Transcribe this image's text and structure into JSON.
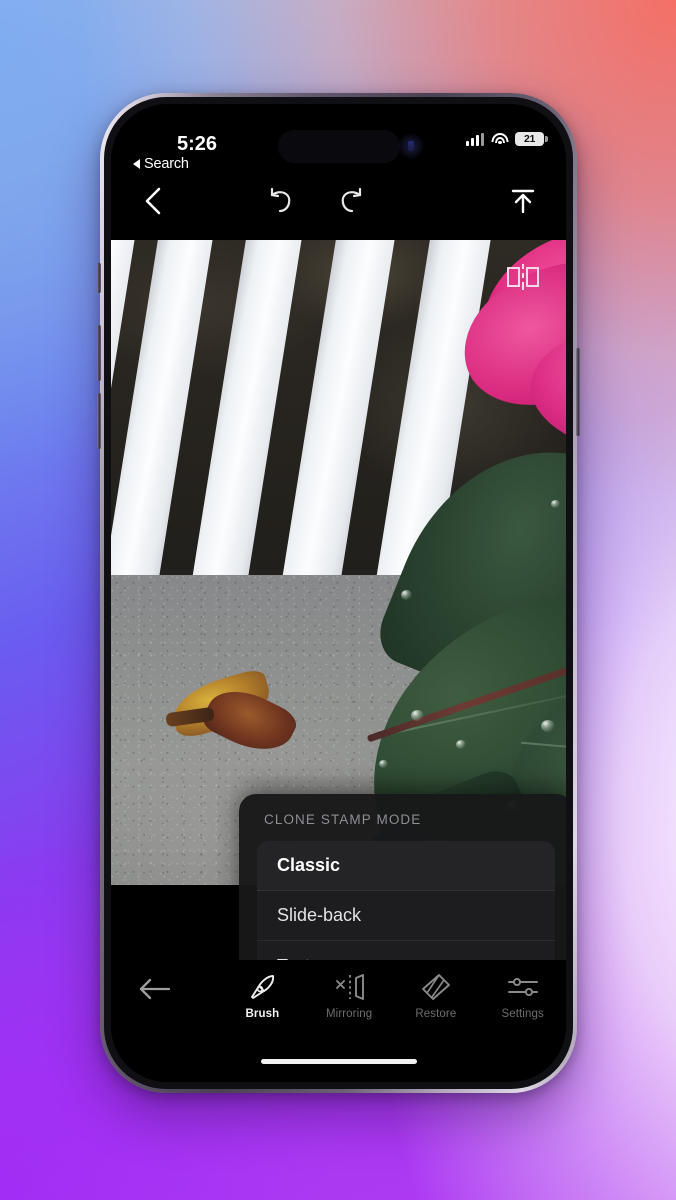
{
  "background": {
    "name": "gradient-wallpaper",
    "colors": {
      "top_left": "#8fb0e8",
      "top_right": "#f8776a",
      "mid_left": "#6a6cf0",
      "bottom_left": "#a32cf5",
      "bottom_right": "#f6f0fb"
    }
  },
  "device": {
    "name": "iPhone 14 Pro",
    "frame_color": "#5a5065"
  },
  "status_bar": {
    "back_label": "Search",
    "back_icon": "triangle-left-icon",
    "time": "5:26",
    "cellular_icon": "signal-bars-icon",
    "wifi_icon": "wifi-icon",
    "battery_icon": "battery-icon",
    "battery_level": "21"
  },
  "top_toolbar": {
    "back_icon": "chevron-left-icon",
    "back_label": "Back",
    "undo_icon": "undo-arrow-icon",
    "undo_label": "Undo",
    "redo_icon": "redo-arrow-icon",
    "redo_label": "Redo",
    "export_icon": "export-upload-icon",
    "export_label": "Export"
  },
  "photo": {
    "name": "rose-and-white-fence-photo",
    "description": "Pink rose with wet green leaves beside a white picket fence on concrete",
    "overlay_flip_icon": "mirror-flip-icon",
    "brush_dial_icon": "brush-size-dial-icon"
  },
  "clone_dialog": {
    "title": "CLONE STAMP MODE",
    "selected": "Classic",
    "options": [
      {
        "label": "Classic",
        "selected": true
      },
      {
        "label": "Slide-back",
        "selected": false
      },
      {
        "label": "Texture",
        "selected": false
      }
    ]
  },
  "bottom_toolbar": {
    "back_icon": "arrow-left-icon",
    "back_label": "Back",
    "active_tab": "Brush",
    "tabs": [
      {
        "label": "Brush",
        "icon": "brush-icon",
        "active": true
      },
      {
        "label": "Mirroring",
        "icon": "mirroring-icon",
        "active": false
      },
      {
        "label": "Restore",
        "icon": "restore-eraser-icon",
        "active": false
      },
      {
        "label": "Settings",
        "icon": "sliders-settings-icon",
        "active": false
      }
    ],
    "home_indicator": "home-indicator"
  }
}
